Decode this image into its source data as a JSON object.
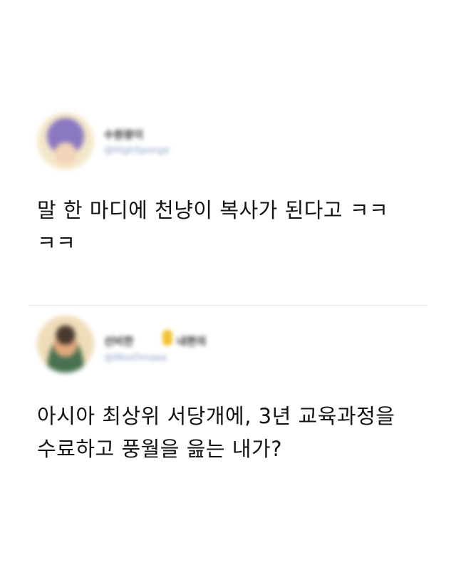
{
  "posts": [
    {
      "name": "수원왕이",
      "handle": "@HighSponge",
      "text": "말 한 마디에 천냥이 복사가 된다고 ㅋㅋ\nㅋㅋ"
    },
    {
      "name": "선비한",
      "name_suffix": "내편의",
      "handle": "@WooOmaaa",
      "text": "아시아 최상위 서당개에, 3년 교육과정을\n수료하고 풍월을 읊는 내가?"
    }
  ],
  "colors": {
    "background": "#ffffff",
    "text": "#141414",
    "divider": "#e6e6e6",
    "handle": "#8aa0c8",
    "badge": "#f2c230"
  }
}
